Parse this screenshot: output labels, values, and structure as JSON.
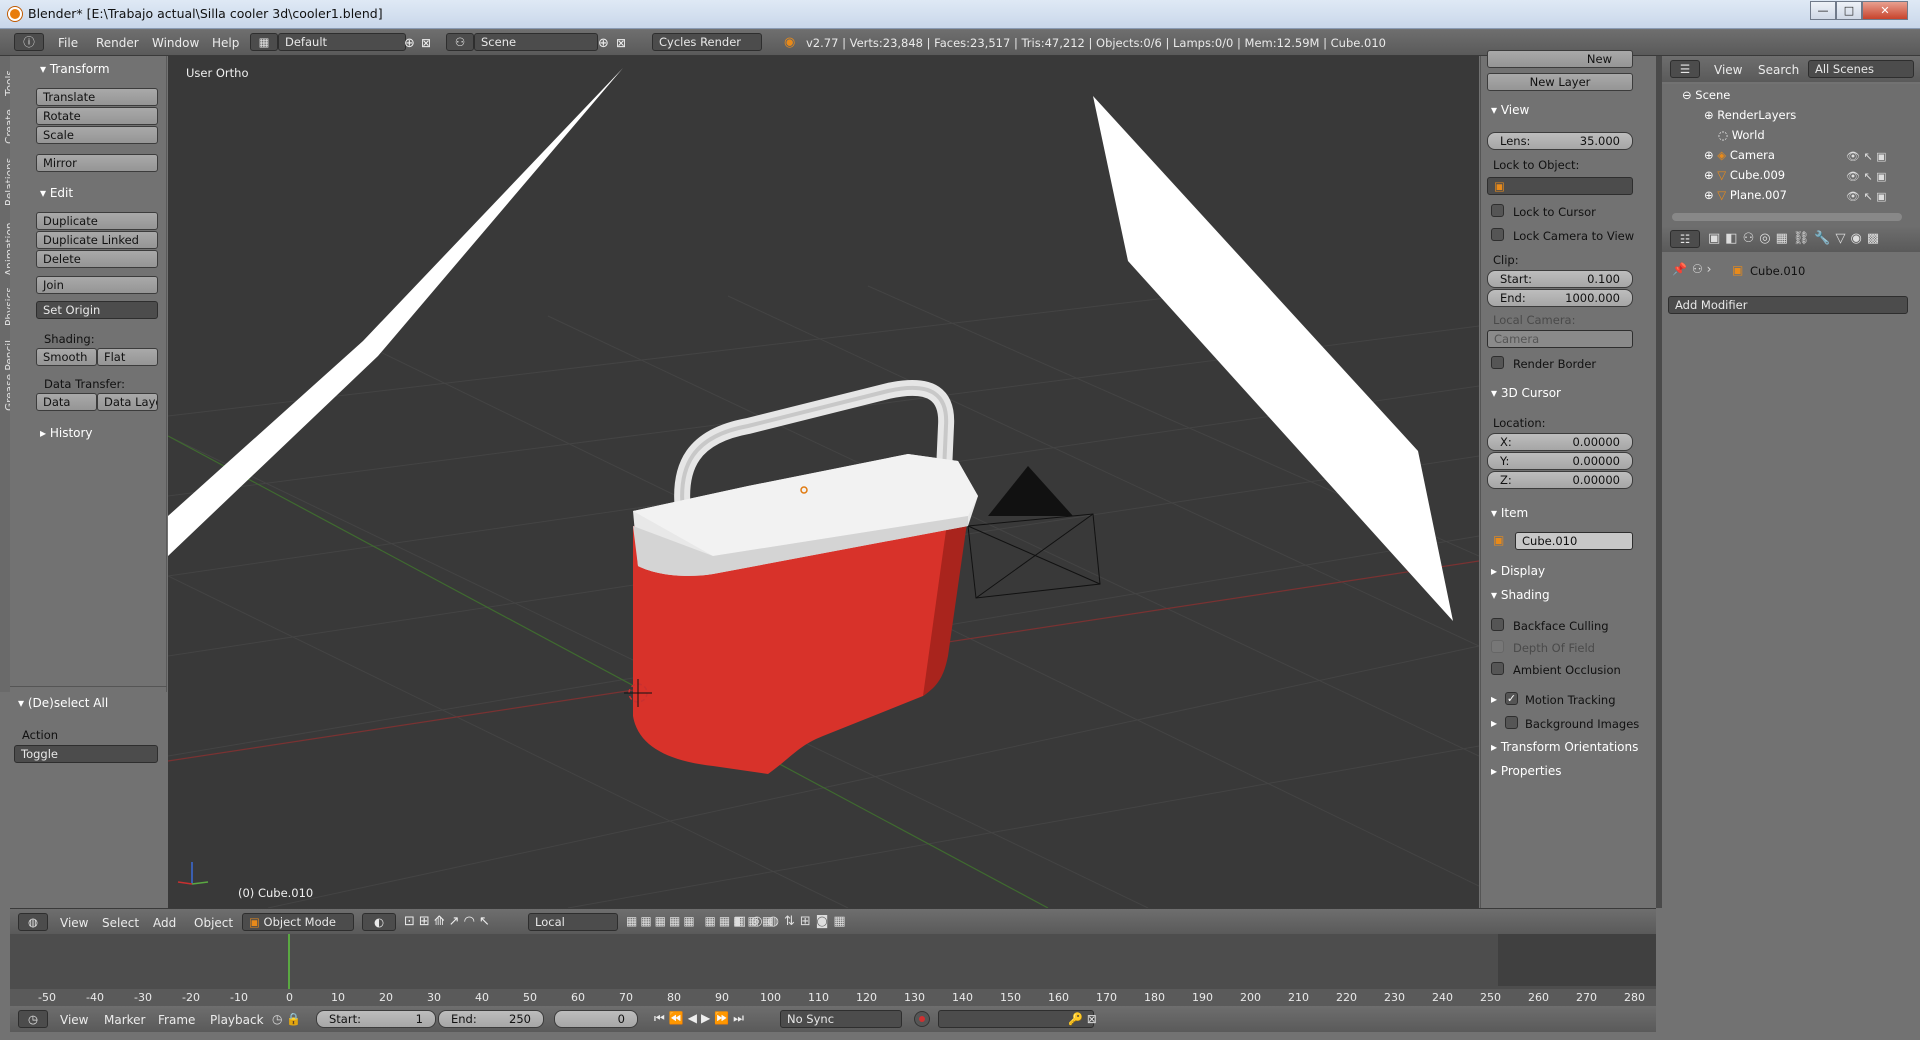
{
  "window": {
    "title": "Blender* [E:\\Trabajo actual\\Silla cooler 3d\\cooler1.blend]",
    "minimize": "—",
    "maximize": "□",
    "close": "✕"
  },
  "topbar": {
    "menus": [
      "File",
      "Render",
      "Window",
      "Help"
    ],
    "layout": "Default",
    "scene": "Scene",
    "engine": "Cycles Render",
    "stats": "v2.77 | Verts:23,848 | Faces:23,517 | Tris:47,212 | Objects:0/6 | Lamps:0/0 | Mem:12.59M | Cube.010"
  },
  "tool_tabs": [
    "Tools",
    "Create",
    "Relations",
    "Animation",
    "Physics",
    "Grease Pencil"
  ],
  "toolshelf": {
    "transform": {
      "title": "Transform",
      "buttons": [
        "Translate",
        "Rotate",
        "Scale",
        "Mirror"
      ]
    },
    "edit": {
      "title": "Edit",
      "buttons": [
        "Duplicate",
        "Duplicate Linked",
        "Delete",
        "Join"
      ],
      "set_origin": "Set Origin"
    },
    "shading": {
      "label": "Shading:",
      "smooth": "Smooth",
      "flat": "Flat"
    },
    "data_transfer": {
      "label": "Data Transfer:",
      "data": "Data",
      "data_layo": "Data Layo"
    },
    "history": "History",
    "operator": {
      "title": "(De)select All",
      "action_label": "Action",
      "action_value": "Toggle"
    }
  },
  "viewport": {
    "view_name": "User Ortho",
    "object_label": "(0) Cube.010",
    "colors": {
      "background": "#393939",
      "cooler_body": "#d8322a",
      "cooler_lid": "#e6e6e6"
    }
  },
  "npanel": {
    "new_btn": "New",
    "new_layer": "New Layer",
    "view": {
      "title": "View",
      "lens_label": "Lens:",
      "lens_value": "35.000",
      "lock_to_object": "Lock to Object:",
      "lock_to_cursor": "Lock to Cursor",
      "lock_camera": "Lock Camera to View",
      "clip": "Clip:",
      "start_label": "Start:",
      "start_value": "0.100",
      "end_label": "End:",
      "end_value": "1000.000",
      "local_camera": "Local Camera:",
      "camera": "Camera",
      "render_border": "Render Border"
    },
    "cursor": {
      "title": "3D Cursor",
      "location": "Location:",
      "x_label": "X:",
      "x_value": "0.00000",
      "y_label": "Y:",
      "y_value": "0.00000",
      "z_label": "Z:",
      "z_value": "0.00000"
    },
    "item": {
      "title": "Item",
      "name": "Cube.010"
    },
    "display": "Display",
    "shading": {
      "title": "Shading",
      "backface": "Backface Culling",
      "dof": "Depth Of Field",
      "ao": "Ambient Occlusion"
    },
    "motion_tracking": "Motion Tracking",
    "background_images": "Background Images",
    "transform_orientations": "Transform Orientations",
    "properties": "Properties"
  },
  "outliner": {
    "view": "View",
    "search": "Search",
    "filter": "All Scenes",
    "items": [
      "Scene",
      "RenderLayers",
      "World",
      "Camera",
      "Cube.009",
      "Plane.007"
    ]
  },
  "properties": {
    "object": "Cube.010",
    "add_modifier": "Add Modifier"
  },
  "viewport_header": {
    "view": "View",
    "select": "Select",
    "add": "Add",
    "object": "Object",
    "mode": "Object Mode",
    "pivot": "Local"
  },
  "timeline": {
    "ticks": [
      "-50",
      "-40",
      "-30",
      "-20",
      "-10",
      "0",
      "10",
      "20",
      "30",
      "40",
      "50",
      "60",
      "70",
      "80",
      "90",
      "100",
      "110",
      "120",
      "130",
      "140",
      "150",
      "160",
      "170",
      "180",
      "190",
      "200",
      "210",
      "220",
      "230",
      "240",
      "250",
      "260",
      "270",
      "280"
    ],
    "view": "View",
    "marker": "Marker",
    "frame": "Frame",
    "playback": "Playback",
    "start_label": "Start:",
    "start_value": "1",
    "end_label": "End:",
    "end_value": "250",
    "current": "0",
    "sync": "No Sync"
  }
}
